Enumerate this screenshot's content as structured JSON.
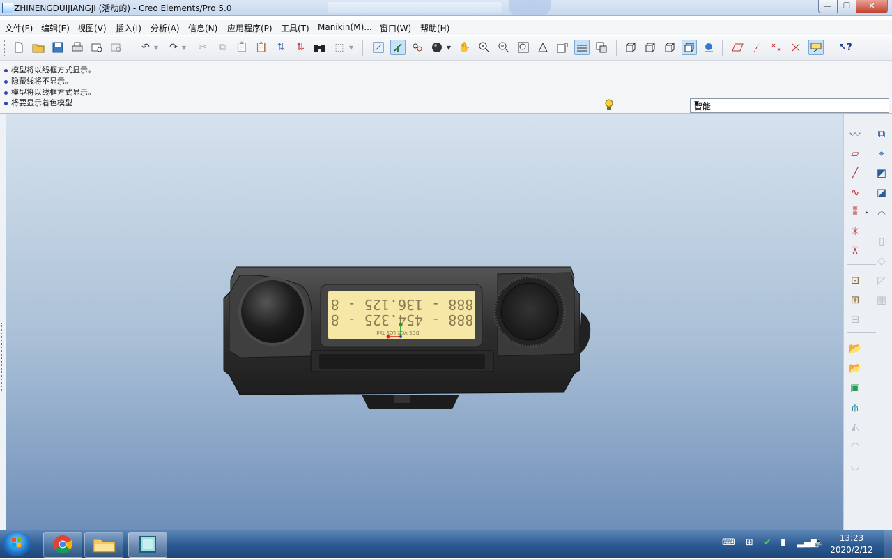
{
  "window": {
    "title": "ZHINENGDUIJIANGJI (活动的) - Creo Elements/Pro 5.0",
    "min": "—",
    "max": "❐",
    "close": "✕"
  },
  "menu": [
    "文件(F)",
    "编辑(E)",
    "视图(V)",
    "插入(I)",
    "分析(A)",
    "信息(N)",
    "应用程序(P)",
    "工具(T)",
    "Manikin(M)...",
    "窗口(W)",
    "帮助(H)"
  ],
  "messages": [
    "模型将以线框方式显示。",
    "隐藏线将不显示。",
    "模型将以线框方式显示。",
    "将要显示着色模型"
  ],
  "filter": {
    "value": "智能",
    "arrow": "▼"
  },
  "model": {
    "lcd_line1": "888 - 136.125 - 8",
    "lcd_line2": "888 - 454.325 - 8",
    "lcd_line3": "DCS  VOX  LOS  Tad"
  },
  "colors": {
    "accent": "#c9e1f6",
    "viewport_top": "#d6e2ee",
    "viewport_bottom": "#6f8fb9",
    "lcd": "#f5e7a5",
    "device_body": "#3a3a3a"
  },
  "taskbar": {
    "time": "13:23",
    "date": "2020/2/12"
  }
}
